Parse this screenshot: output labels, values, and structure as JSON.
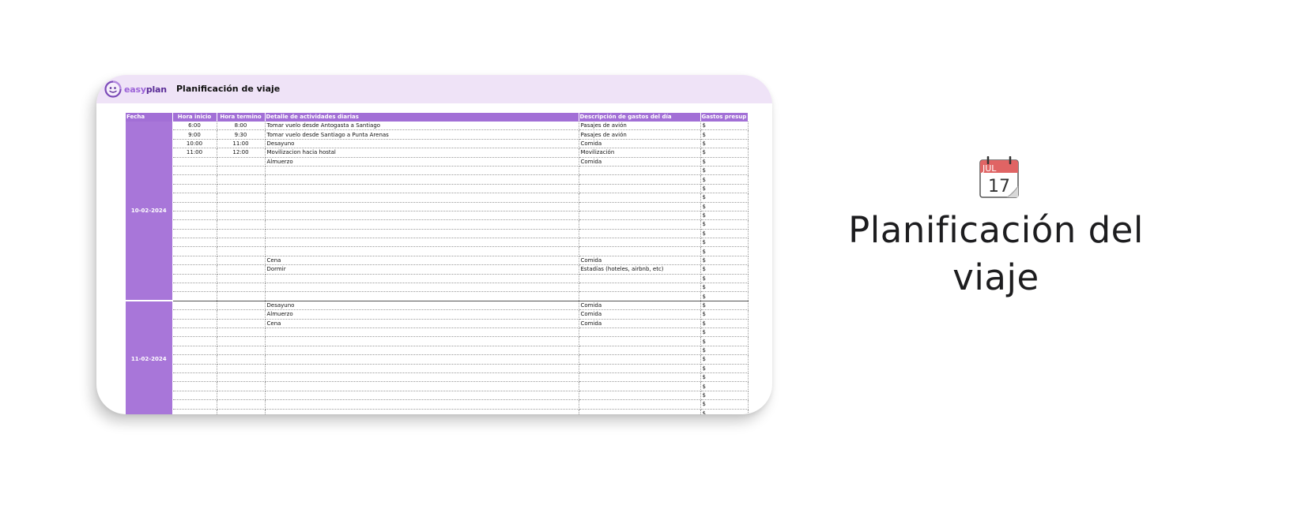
{
  "app": {
    "brand_part1": "easy",
    "brand_part2": "plan",
    "sheet_title": "Planificación de viaje"
  },
  "colors": {
    "header_bg": "#efe3f7",
    "accent": "#a26fd6",
    "brand": "#7c4bb8"
  },
  "table": {
    "columns": [
      "Fecha",
      "Hora inicio",
      "Hora termino",
      "Detalle de actividades diarias",
      "Descripción de gastos del día",
      "Gastos presup"
    ],
    "currency_symbol": "$",
    "days": [
      {
        "date": "10-02-2024",
        "rows": [
          {
            "start": "6:00",
            "end": "8:00",
            "activity": "Tomar vuelo desde Antogasta a Santiago",
            "expense": "Pasajes de avión"
          },
          {
            "start": "9:00",
            "end": "9:30",
            "activity": "Tomar vuelo desde Santiago a Punta Arenas",
            "expense": "Pasajes de avión"
          },
          {
            "start": "10:00",
            "end": "11:00",
            "activity": "Desayuno",
            "expense": "Comida"
          },
          {
            "start": "11:00",
            "end": "12:00",
            "activity": "Movilizacion hacia hostal",
            "expense": "Movilización"
          },
          {
            "start": "",
            "end": "",
            "activity": "Almuerzo",
            "expense": "Comida"
          },
          {
            "start": "",
            "end": "",
            "activity": "",
            "expense": ""
          },
          {
            "start": "",
            "end": "",
            "activity": "",
            "expense": ""
          },
          {
            "start": "",
            "end": "",
            "activity": "",
            "expense": ""
          },
          {
            "start": "",
            "end": "",
            "activity": "",
            "expense": ""
          },
          {
            "start": "",
            "end": "",
            "activity": "",
            "expense": ""
          },
          {
            "start": "",
            "end": "",
            "activity": "",
            "expense": ""
          },
          {
            "start": "",
            "end": "",
            "activity": "",
            "expense": ""
          },
          {
            "start": "",
            "end": "",
            "activity": "",
            "expense": ""
          },
          {
            "start": "",
            "end": "",
            "activity": "",
            "expense": ""
          },
          {
            "start": "",
            "end": "",
            "activity": "",
            "expense": ""
          },
          {
            "start": "",
            "end": "",
            "activity": "Cena",
            "expense": "Comida"
          },
          {
            "start": "",
            "end": "",
            "activity": "Dormir",
            "expense": "Estadías (hoteles, airbnb, etc)"
          },
          {
            "start": "",
            "end": "",
            "activity": "",
            "expense": ""
          },
          {
            "start": "",
            "end": "",
            "activity": "",
            "expense": ""
          },
          {
            "start": "",
            "end": "",
            "activity": "",
            "expense": ""
          }
        ]
      },
      {
        "date": "11-02-2024",
        "rows": [
          {
            "start": "",
            "end": "",
            "activity": "Desayuno",
            "expense": "Comida"
          },
          {
            "start": "",
            "end": "",
            "activity": "Almuerzo",
            "expense": "Comida"
          },
          {
            "start": "",
            "end": "",
            "activity": "Cena",
            "expense": "Comida"
          },
          {
            "start": "",
            "end": "",
            "activity": "",
            "expense": ""
          },
          {
            "start": "",
            "end": "",
            "activity": "",
            "expense": ""
          },
          {
            "start": "",
            "end": "",
            "activity": "",
            "expense": ""
          },
          {
            "start": "",
            "end": "",
            "activity": "",
            "expense": ""
          },
          {
            "start": "",
            "end": "",
            "activity": "",
            "expense": ""
          },
          {
            "start": "",
            "end": "",
            "activity": "",
            "expense": ""
          },
          {
            "start": "",
            "end": "",
            "activity": "",
            "expense": ""
          },
          {
            "start": "",
            "end": "",
            "activity": "",
            "expense": ""
          },
          {
            "start": "",
            "end": "",
            "activity": "",
            "expense": ""
          },
          {
            "start": "",
            "end": "",
            "activity": "",
            "expense": ""
          }
        ]
      }
    ]
  },
  "hero": {
    "icon": "calendar-icon",
    "calendar_month": "JUL",
    "calendar_day": "17",
    "title_line1": "Planificación del",
    "title_line2": "viaje"
  }
}
